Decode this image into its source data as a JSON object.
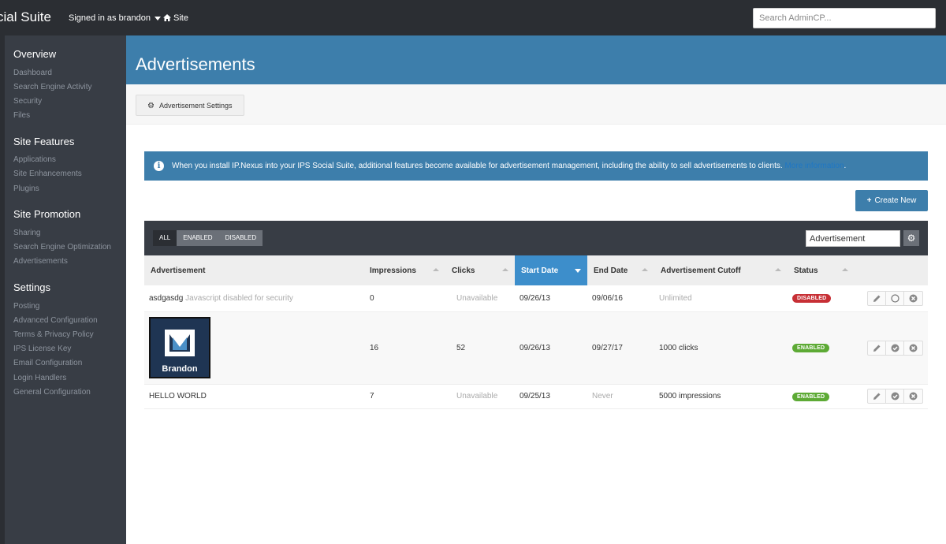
{
  "topbar": {
    "brand": "cial Suite",
    "signed_in": "Signed in as brandon",
    "site_link": "Site",
    "search_placeholder": "Search AdminCP..."
  },
  "sidebar": {
    "sections": [
      {
        "title": "Overview",
        "items": [
          "Dashboard",
          "Search Engine Activity",
          "Security",
          "Files"
        ]
      },
      {
        "title": "Site Features",
        "items": [
          "Applications",
          "Site Enhancements",
          "Plugins"
        ]
      },
      {
        "title": "Site Promotion",
        "items": [
          "Sharing",
          "Search Engine Optimization",
          "Advertisements"
        ]
      },
      {
        "title": "Settings",
        "items": [
          "Posting",
          "Advanced Configuration",
          "Terms & Privacy Policy",
          "IPS License Key",
          "Email Configuration",
          "Login Handlers",
          "General Configuration"
        ]
      }
    ]
  },
  "page": {
    "title": "Advertisements",
    "settings_button": "Advertisement Settings",
    "info_text": "When you install IP.Nexus into your IPS Social Suite, additional features become available for advertisement management, including the ability to sell advertisements to clients.",
    "info_link": "More information",
    "info_period": ".",
    "create_button": "Create New"
  },
  "filters": {
    "all": "ALL",
    "enabled": "ENABLED",
    "disabled": "DISABLED",
    "search_value": "Advertisement"
  },
  "table": {
    "headers": {
      "advertisement": "Advertisement",
      "impressions": "Impressions",
      "clicks": "Clicks",
      "start_date": "Start Date",
      "end_date": "End Date",
      "cutoff": "Advertisement Cutoff",
      "status": "Status"
    },
    "rows": [
      {
        "name": "asdgasdg",
        "note": "Javascript disabled for security",
        "impressions": "0",
        "clicks": "Unavailable",
        "start": "09/26/13",
        "end": "09/06/16",
        "cutoff": "Unlimited",
        "status": "DISABLED"
      },
      {
        "image_text": "Brandon",
        "impressions": "16",
        "clicks": "52",
        "start": "09/26/13",
        "end": "09/27/17",
        "cutoff": "1000 clicks",
        "status": "ENABLED"
      },
      {
        "name": "HELLO WORLD",
        "impressions": "7",
        "clicks": "Unavailable",
        "start": "09/25/13",
        "end": "Never",
        "cutoff": "5000 impressions",
        "status": "ENABLED"
      }
    ]
  },
  "colors": {
    "accent": "#3d7eab",
    "sidebar": "#383d45",
    "topbar": "#2b2e33",
    "danger": "#c72f35",
    "success": "#5daa35"
  }
}
